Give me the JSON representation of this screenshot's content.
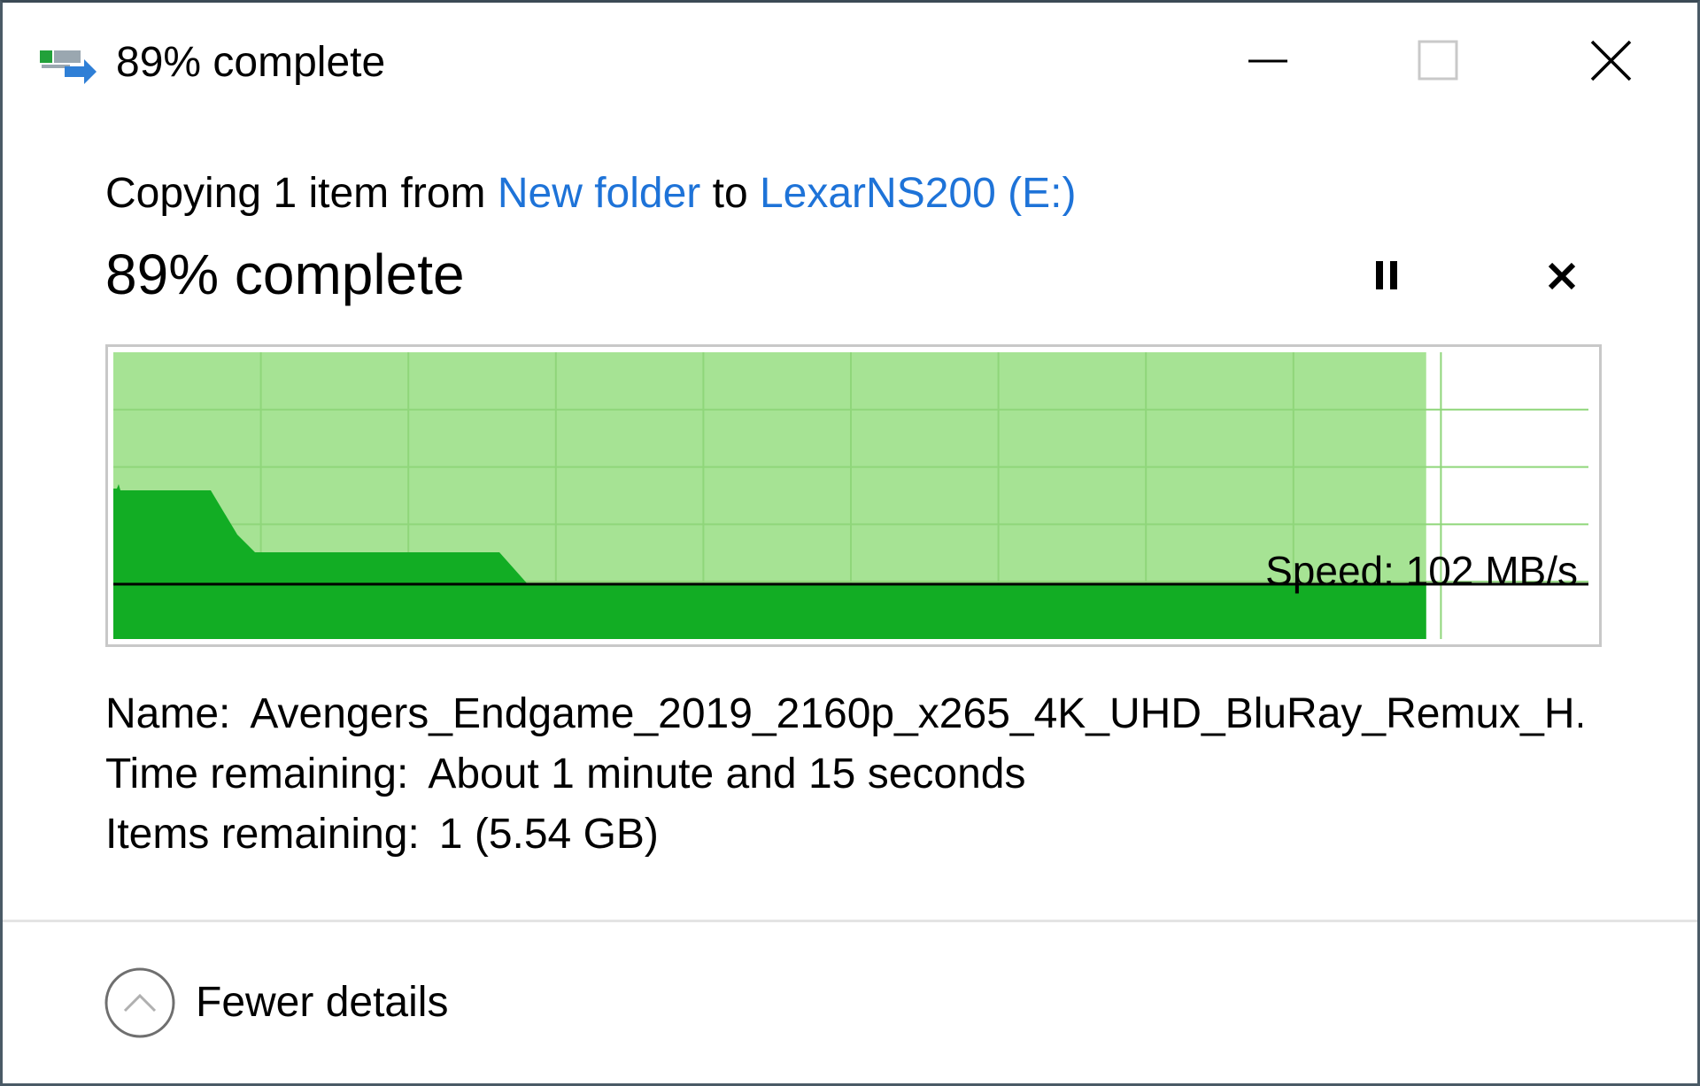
{
  "window": {
    "title": "89% complete",
    "icon": "file-copy-icon",
    "controls": [
      "minimize-icon",
      "maximize-icon",
      "close-icon"
    ]
  },
  "header": {
    "copy_prefix": "Copying 1 item from ",
    "source": "New folder",
    "copy_middle": " to ",
    "destination": "LexarNS200 (E:)",
    "percent_text": "89% complete"
  },
  "actions": {
    "pause_icon": "pause-icon",
    "cancel_icon": "cancel-icon"
  },
  "progress": {
    "percent": 89,
    "speed_text": "Speed: 102 MB/s",
    "colors": {
      "completed_fill": "#a6e394",
      "speed_fill": "#12ad24",
      "grid": "#8fd67a",
      "speed_line": "#000000"
    }
  },
  "details": {
    "name_label": "Name:",
    "name_value": "Avengers_Endgame_2019_2160p_x265_4K_UHD_BluRay_Remux_H...",
    "time_label": "Time remaining:",
    "time_value": "About 1 minute and 15 seconds",
    "items_label": "Items remaining:",
    "items_value": "1 (5.54 GB)"
  },
  "footer": {
    "toggle_label": "Fewer details",
    "toggle_icon": "chevron-up-circle-icon"
  },
  "colors": {
    "link": "#1e73d8"
  }
}
